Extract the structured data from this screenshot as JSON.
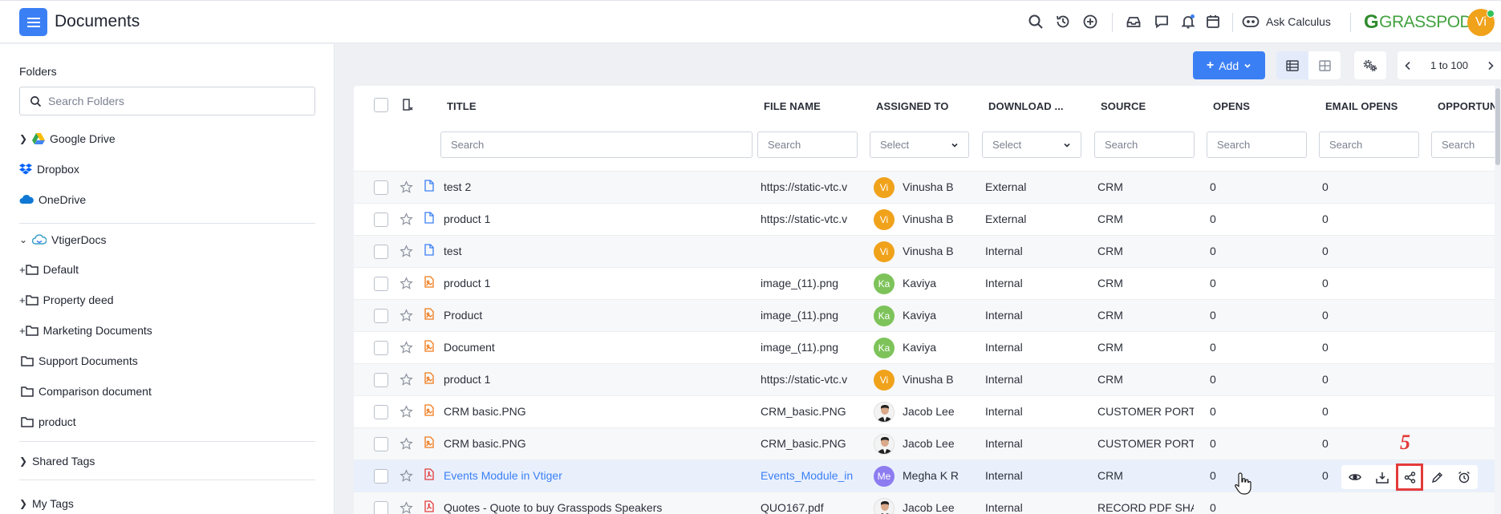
{
  "header": {
    "title": "Documents",
    "ask_label": "Ask Calculus",
    "logo_text": "GRASSPODS",
    "logo_letter": "G",
    "avatar": "Vi"
  },
  "sidebar": {
    "folders_label": "Folders",
    "search_placeholder": "Search Folders",
    "items": [
      {
        "label": "Google Drive"
      },
      {
        "label": "Dropbox"
      },
      {
        "label": "OneDrive"
      },
      {
        "label": "VtigerDocs"
      },
      {
        "label": "Default"
      },
      {
        "label": "Property deed"
      },
      {
        "label": "Marketing Documents"
      },
      {
        "label": "Support Documents"
      },
      {
        "label": "Comparison document"
      },
      {
        "label": "product"
      },
      {
        "label": "Shared Tags"
      },
      {
        "label": "My Tags"
      }
    ]
  },
  "toolbar": {
    "add_label": "Add",
    "pager_label": "1 to 100"
  },
  "table": {
    "columns": [
      "TITLE",
      "FILE NAME",
      "ASSIGNED TO",
      "DOWNLOAD ...",
      "SOURCE",
      "OPENS",
      "EMAIL OPENS",
      "OPPORTUN"
    ],
    "search_placeholder": "Search",
    "select_placeholder": "Select",
    "rows": [
      {
        "title": "test 2",
        "file": "https://static-vtc.v",
        "av": "Vi",
        "assignee": "Vinusha B",
        "download": "External",
        "source": "CRM",
        "opens": "0",
        "email_opens": "0"
      },
      {
        "title": "product 1",
        "file": "https://static-vtc.v",
        "av": "Vi",
        "assignee": "Vinusha B",
        "download": "External",
        "source": "CRM",
        "opens": "0",
        "email_opens": "0"
      },
      {
        "title": "test",
        "file": "",
        "av": "Vi",
        "assignee": "Vinusha B",
        "download": "Internal",
        "source": "CRM",
        "opens": "0",
        "email_opens": "0"
      },
      {
        "title": "product 1",
        "file": "image_(11).png",
        "av": "Ka",
        "assignee": "Kaviya",
        "download": "Internal",
        "source": "CRM",
        "opens": "0",
        "email_opens": "0"
      },
      {
        "title": "Product",
        "file": "image_(11).png",
        "av": "Ka",
        "assignee": "Kaviya",
        "download": "Internal",
        "source": "CRM",
        "opens": "0",
        "email_opens": "0"
      },
      {
        "title": "Document",
        "file": "image_(11).png",
        "av": "Ka",
        "assignee": "Kaviya",
        "download": "Internal",
        "source": "CRM",
        "opens": "0",
        "email_opens": "0"
      },
      {
        "title": "product 1",
        "file": "https://static-vtc.v",
        "av": "Vi",
        "assignee": "Vinusha B",
        "download": "Internal",
        "source": "CRM",
        "opens": "0",
        "email_opens": "0"
      },
      {
        "title": "CRM basic.PNG",
        "file": "CRM_basic.PNG",
        "av": "",
        "assignee": "Jacob Lee",
        "download": "Internal",
        "source": "CUSTOMER PORTAL",
        "opens": "0",
        "email_opens": "0"
      },
      {
        "title": "CRM basic.PNG",
        "file": "CRM_basic.PNG",
        "av": "",
        "assignee": "Jacob Lee",
        "download": "Internal",
        "source": "CUSTOMER PORTAL",
        "opens": "0",
        "email_opens": "0"
      },
      {
        "title": "Events Module in Vtiger",
        "file": "Events_Module_in",
        "av": "Me",
        "assignee": "Megha K R",
        "download": "Internal",
        "source": "CRM",
        "opens": "0",
        "email_opens": "0"
      },
      {
        "title": "Quotes - Quote to buy Grasspods Speakers",
        "file": "QUO167.pdf",
        "av": "",
        "assignee": "Jacob Lee",
        "download": "Internal",
        "source": "RECORD PDF SHARI",
        "opens": "0",
        "email_opens": ""
      }
    ]
  },
  "annotation": {
    "number": "5"
  },
  "colors": {
    "accent": "#3b7ff5",
    "vi": "#f0a21b",
    "ka": "#7dc35a",
    "me": "#8c7cf0",
    "annotation": "#e33b3b"
  }
}
